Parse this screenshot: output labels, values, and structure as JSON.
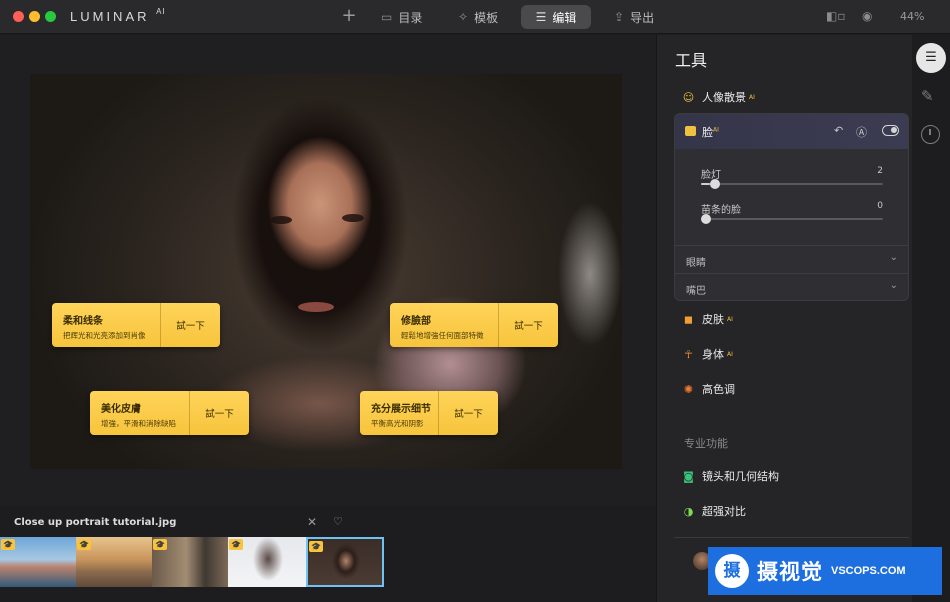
{
  "app": {
    "logo": "LUMINAR",
    "logo_suffix": "AI",
    "zoom": "44%"
  },
  "nav": {
    "tabs": [
      {
        "label": "目录",
        "icon": "folder-icon"
      },
      {
        "label": "模板",
        "icon": "magic-wand-icon"
      },
      {
        "label": "编辑",
        "icon": "sliders-icon",
        "active": true
      },
      {
        "label": "导出",
        "icon": "share-icon"
      }
    ]
  },
  "canvas": {
    "tips": [
      {
        "title": "柔和线条",
        "desc": "把辉光和光亮添加到肖像",
        "action": "試一下"
      },
      {
        "title": "修臉部",
        "desc": "輕鬆地增強任何面部特徵",
        "action": "試一下"
      },
      {
        "title": "美化皮膚",
        "desc": "增強，平滑和消除缺陷",
        "action": "試一下"
      },
      {
        "title": "充分展示细节",
        "desc": "平衡高光和阴影",
        "action": "試一下"
      }
    ]
  },
  "filmstrip": {
    "filename": "Close up portrait tutorial.jpg",
    "badge": "🎓"
  },
  "panel": {
    "title": "工具",
    "portrait_bokeh": {
      "label": "人像散景",
      "ai": "AI"
    },
    "face": {
      "title": "脸",
      "ai": "AI",
      "sliders": [
        {
          "label": "脸灯",
          "value": 2,
          "fraction": 0.05
        },
        {
          "label": "苗条的脸",
          "value": 0,
          "fraction": 0.0
        }
      ],
      "sections": [
        {
          "label": "眼睛"
        },
        {
          "label": "嘴巴"
        }
      ]
    },
    "skin": {
      "label": "皮肤",
      "ai": "AI"
    },
    "body": {
      "label": "身体",
      "ai": "AI"
    },
    "highkey": {
      "label": "高色调"
    },
    "pro_label": "专业功能",
    "lens": {
      "label": "镜头和几何结构"
    },
    "supercontrast": {
      "label": "超强对比"
    }
  },
  "watermark": {
    "cn": "摄视觉",
    "en": "VSCOPS.COM",
    "logo_char": "摄"
  },
  "colors": {
    "accent_yellow": "#f7c43c",
    "selected_border": "#6ec3f3",
    "watermark_blue": "#1d6fe0"
  }
}
